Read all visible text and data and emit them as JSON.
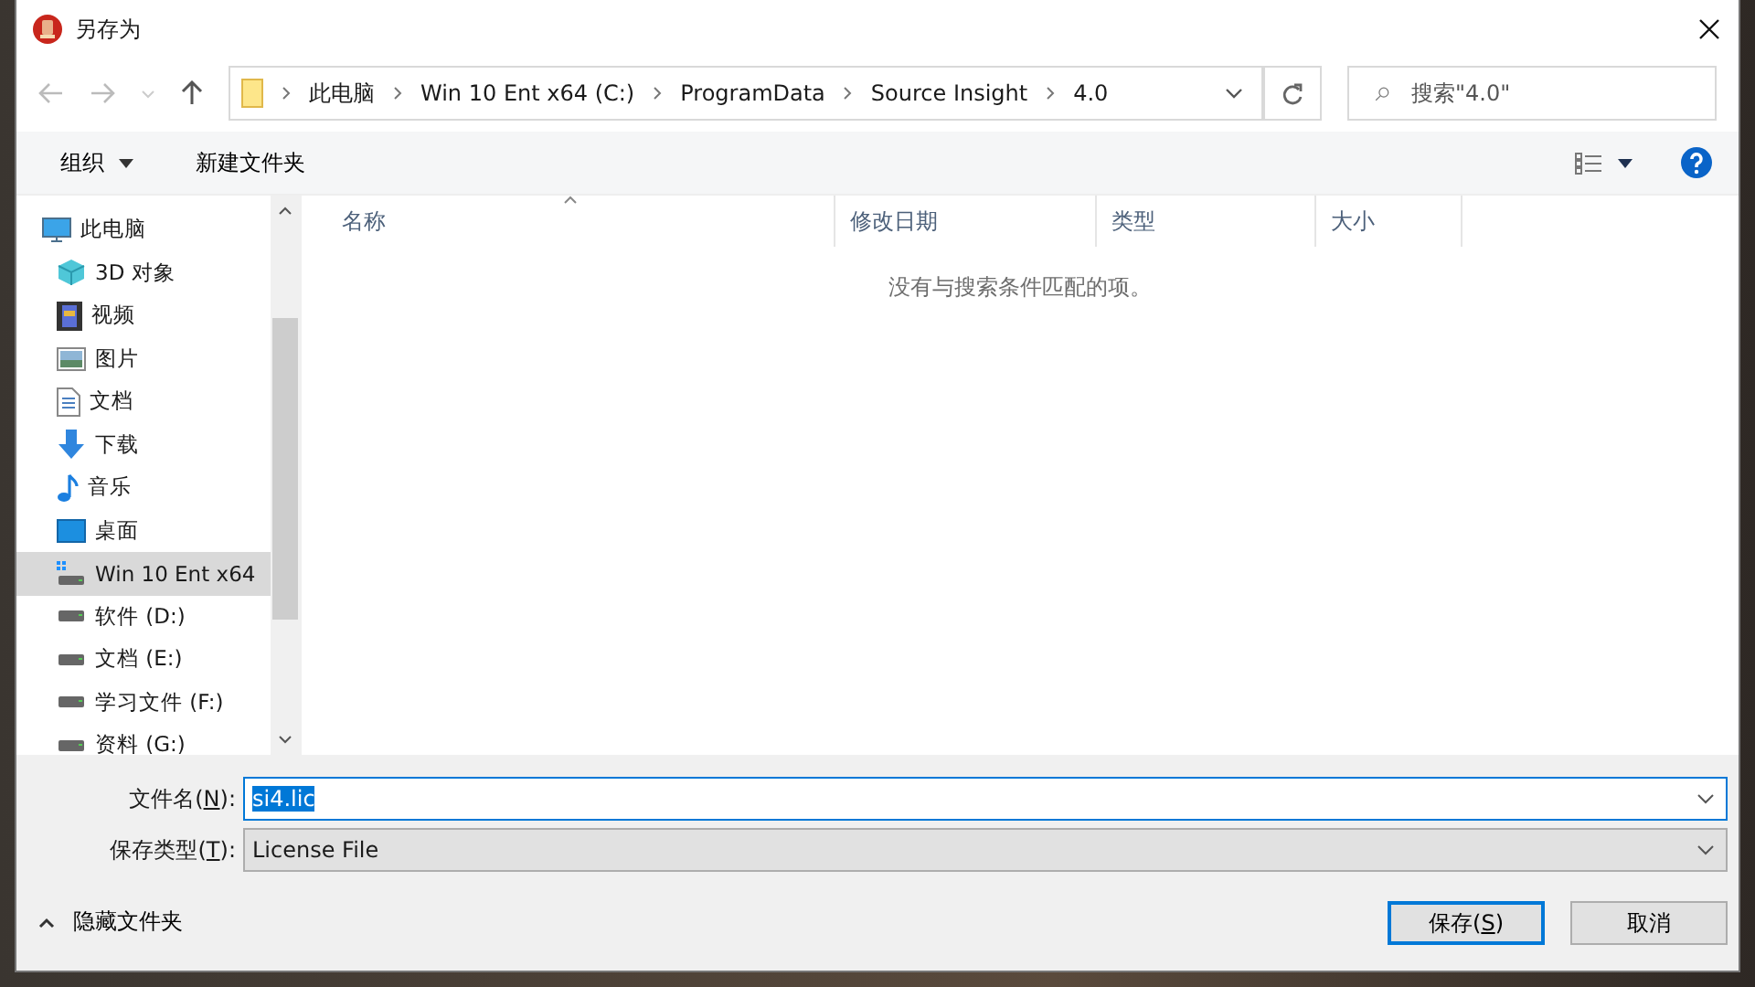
{
  "window": {
    "title": "另存为"
  },
  "address": {
    "crumbs": [
      "此电脑",
      "Win 10 Ent x64 (C:)",
      "ProgramData",
      "Source Insight",
      "4.0"
    ]
  },
  "search": {
    "placeholder": "搜索\"4.0\""
  },
  "toolbar": {
    "organize": "组织",
    "new_folder": "新建文件夹"
  },
  "sidebar": {
    "items": [
      {
        "label": "此电脑",
        "kind": "pc",
        "selected": false
      },
      {
        "label": "3D 对象",
        "kind": "cube",
        "selected": false
      },
      {
        "label": "视频",
        "kind": "video",
        "selected": false
      },
      {
        "label": "图片",
        "kind": "picture",
        "selected": false
      },
      {
        "label": "文档",
        "kind": "document",
        "selected": false
      },
      {
        "label": "下载",
        "kind": "download",
        "selected": false
      },
      {
        "label": "音乐",
        "kind": "music",
        "selected": false
      },
      {
        "label": "桌面",
        "kind": "desktop",
        "selected": false
      },
      {
        "label": "Win 10 Ent x64",
        "kind": "system-drive",
        "selected": true
      },
      {
        "label": "软件 (D:)",
        "kind": "drive",
        "selected": false
      },
      {
        "label": "文档 (E:)",
        "kind": "drive",
        "selected": false
      },
      {
        "label": "学习文件 (F:)",
        "kind": "drive",
        "selected": false
      },
      {
        "label": "资料 (G:)",
        "kind": "drive",
        "selected": false
      }
    ]
  },
  "file_list": {
    "columns": [
      {
        "label": "名称",
        "sorted": true
      },
      {
        "label": "修改日期",
        "sorted": false
      },
      {
        "label": "类型",
        "sorted": false
      },
      {
        "label": "大小",
        "sorted": false
      }
    ],
    "empty_message": "没有与搜索条件匹配的项。"
  },
  "form": {
    "file_name_label": {
      "before": "文件名(",
      "key": "N",
      "after": "):"
    },
    "file_name": "si4.lic",
    "file_type_label": {
      "before": "保存类型(",
      "key": "T",
      "after": "):"
    },
    "file_type": "License File"
  },
  "footer": {
    "hide_folders": "隐藏文件夹",
    "save": {
      "before": "保存(",
      "key": "S",
      "after": ")"
    },
    "cancel": "取消"
  }
}
